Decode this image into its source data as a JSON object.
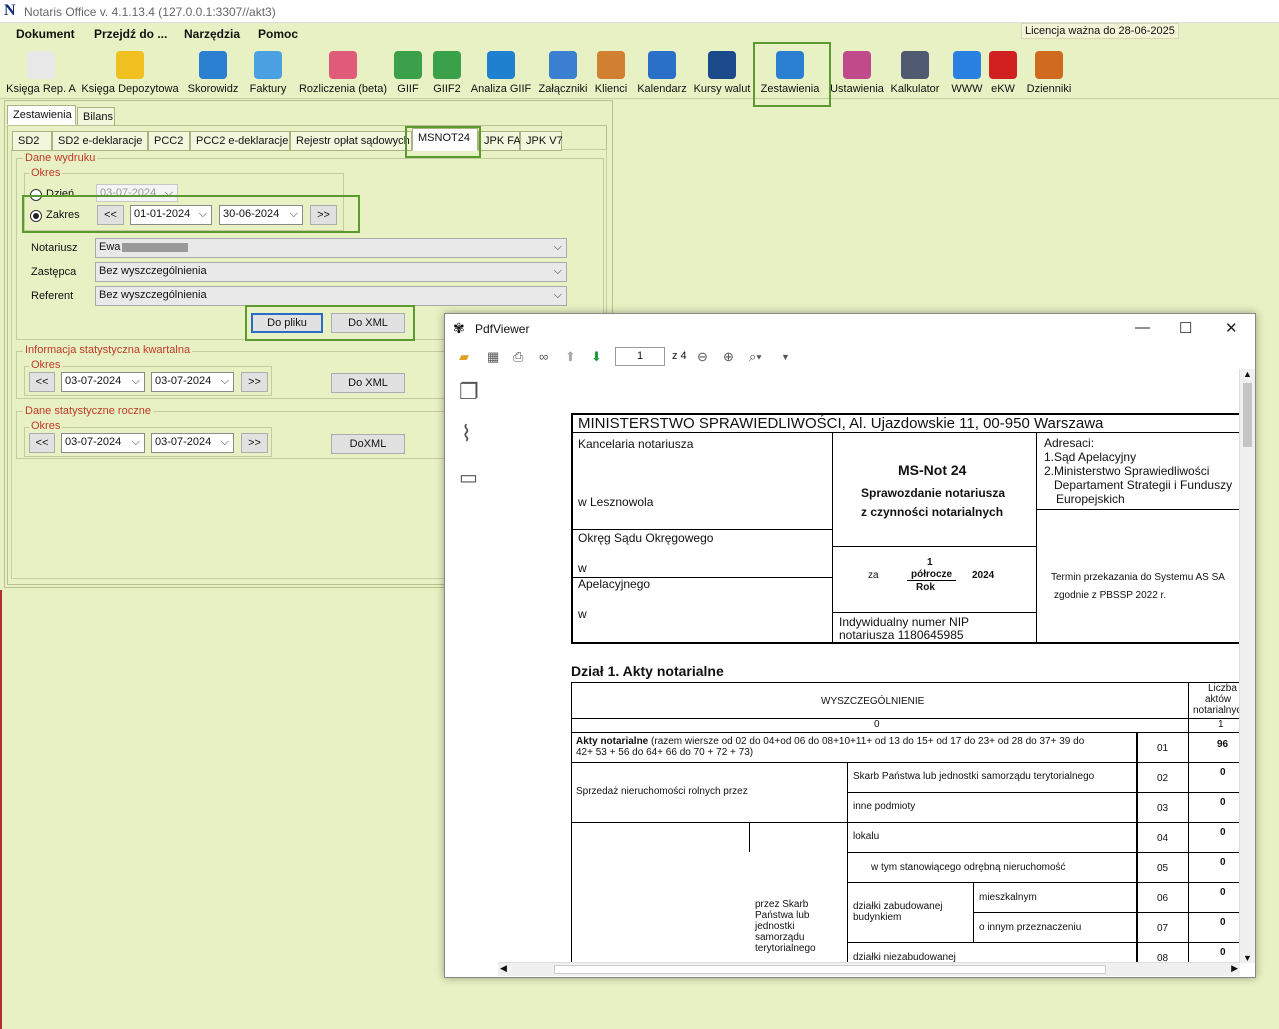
{
  "app": {
    "title": "Notaris Office v. 4.1.13.4 (127.0.0.1:3307//akt3)",
    "license": "Licencja ważna do 28-06-2025"
  },
  "menu": [
    "Dokument",
    "Przejdź do ...",
    "Narzędzia",
    "Pomoc"
  ],
  "toolbar": [
    {
      "label": "Księga Rep. A",
      "icon": "book-icon",
      "color": "#e8e8e8"
    },
    {
      "label": "Księga Depozytowa",
      "icon": "coins-icon",
      "color": "#f0c020"
    },
    {
      "label": "Skorowidz",
      "icon": "index-icon",
      "color": "#2a7fd0"
    },
    {
      "label": "Faktury",
      "icon": "invoice-icon",
      "color": "#4aa0e0"
    },
    {
      "label": "Rozliczenia (beta)",
      "icon": "piggy-bank-icon",
      "color": "#e05a7a"
    },
    {
      "label": "GIIF",
      "icon": "money-icon",
      "color": "#3aa04a"
    },
    {
      "label": "GIIF2",
      "icon": "money-icon",
      "color": "#3aa04a"
    },
    {
      "label": "Analiza GIIF",
      "icon": "dollar-search-icon",
      "color": "#2080d0"
    },
    {
      "label": "Załączniki",
      "icon": "paperclip-icon",
      "color": "#3a7fd0"
    },
    {
      "label": "Klienci",
      "icon": "people-icon",
      "color": "#d08030"
    },
    {
      "label": "Kalendarz",
      "icon": "calendar-icon",
      "color": "#2a70c8"
    },
    {
      "label": "Kursy walut",
      "icon": "euro-icon",
      "color": "#1a4a8a"
    },
    {
      "label": "Zestawienia",
      "icon": "report-icon",
      "color": "#2a7fd0"
    },
    {
      "label": "Ustawienia",
      "icon": "settings-monitor-icon",
      "color": "#c04a8a"
    },
    {
      "label": "Kalkulator",
      "icon": "calculator-icon",
      "color": "#505a70"
    },
    {
      "label": "WWW",
      "icon": "globe-icon",
      "color": "#2a80e0"
    },
    {
      "label": "eKW",
      "icon": "ekw-emblem-icon",
      "color": "#d02020"
    },
    {
      "label": "Dzienniki",
      "icon": "books-icon",
      "color": "#d06a20"
    }
  ],
  "top_tabs": [
    "Zestawienia",
    "Bilans"
  ],
  "sub_tabs": [
    "SD2",
    "SD2 e-deklaracje",
    "PCC2",
    "PCC2 e-deklaracje",
    "Rejestr opłat sądowych",
    "MSNOT24",
    "JPK FA",
    "JPK V7"
  ],
  "form": {
    "dane_wydruku": "Dane wydruku",
    "okres": "Okres",
    "dzien_label": "Dzień",
    "dzien_value": "03-07-2024",
    "zakres_label": "Zakres",
    "prev": "<<",
    "next": ">>",
    "date_from": "01-01-2024",
    "date_to": "30-06-2024",
    "notariusz_label": "Notariusz",
    "notariusz_value": "Ewa",
    "zastepca_label": "Zastępca",
    "zastepca_value": "Bez wyszczególnienia",
    "referent_label": "Referent",
    "referent_value": "Bez wyszczególnienia",
    "do_pliku": "Do pliku",
    "do_xml": "Do XML",
    "kwartal_title": "Informacja statystyczna kwartalna",
    "kwartal_from": "03-07-2024",
    "kwartal_to": "03-07-2024",
    "kwartal_btn": "Do XML",
    "roczne_title": "Dane statystyczne roczne",
    "roczne_from": "03-07-2024",
    "roczne_to": "03-07-2024",
    "roczne_btn": "DoXML"
  },
  "pdf": {
    "title": "PdfViewer",
    "page": "1",
    "of": "z 4",
    "header": "MINISTERSTWO SPRAWIEDLIWOŚCI, Al. Ujazdowskie 11, 00-950 Warszawa",
    "kancelaria": "Kancelaria notariusza",
    "w_lesznowola": "w Lesznowola",
    "okreg": "Okręg Sądu Okręgowego",
    "w": "w",
    "apel": "Apelacyjnego",
    "msnot": "MS-Not 24",
    "spraw1": "Sprawozdanie notariusza",
    "spraw2": "z czynności notarialnych",
    "za": "za",
    "one": "1",
    "polrocze": "półrocze",
    "year": "2024",
    "rok": "Rok",
    "nip1": "Indywidualny numer NIP",
    "nip2": "notariusza 1180645985",
    "adresaci": "Adresaci:",
    "adr1": "1.Sąd Apelacyjny",
    "adr2": "2.Ministerstwo Sprawiedliwości",
    "adr3": "Departament Strategii i Funduszy",
    "adr4": "Europejskich",
    "termin1": "Termin przekazania do Systemu AS SA",
    "termin2": "zgodnie z PBSSP 2022 r.",
    "dzial": "Dział 1. Akty notarialne",
    "wyszczeg": "WYSZCZEGÓLNIENIE",
    "liczba1": "Liczba",
    "liczba2": "aktów",
    "liczba3": "notarialnych",
    "zero": "0",
    "onecol": "1",
    "akty_b": "Akty notarialne",
    "akty_rest": " (razem wiersze od 02 do 04+od 06 do 08+10+11+ od 13 do 15+ od 17 do 23+ od 28 do 37+ 39 do",
    "akty_rest2": "42+ 53 + 56 do 64+ 66 do 70 + 72 + 73)",
    "sprzedaz": "Sprzedaż nieruchomości rolnych przez",
    "skarb": "Skarb Państwa lub jednostki samorządu terytorialnego",
    "inne": "inne podmioty",
    "lokalu": "lokalu",
    "wtym": "w tym stanowiącego odrębną nieruchomość",
    "przez1": "przez Skarb",
    "przez2": "Państwa lub",
    "przez3": "jednostki",
    "przez4": "samorządu",
    "przez5": "terytorialnego",
    "dzialki1": "działki zabudowanej",
    "dzialki2": "budynkiem",
    "mieszk": "mieszkalnym",
    "innym": "o innym przeznaczeniu",
    "niezab": "działki niezabudowanej",
    "rows": [
      {
        "no": "01",
        "val": "96"
      },
      {
        "no": "02",
        "val": "0"
      },
      {
        "no": "03",
        "val": "0"
      },
      {
        "no": "04",
        "val": "0"
      },
      {
        "no": "05",
        "val": "0"
      },
      {
        "no": "06",
        "val": "0"
      },
      {
        "no": "07",
        "val": "0"
      },
      {
        "no": "08",
        "val": "0"
      }
    ]
  }
}
